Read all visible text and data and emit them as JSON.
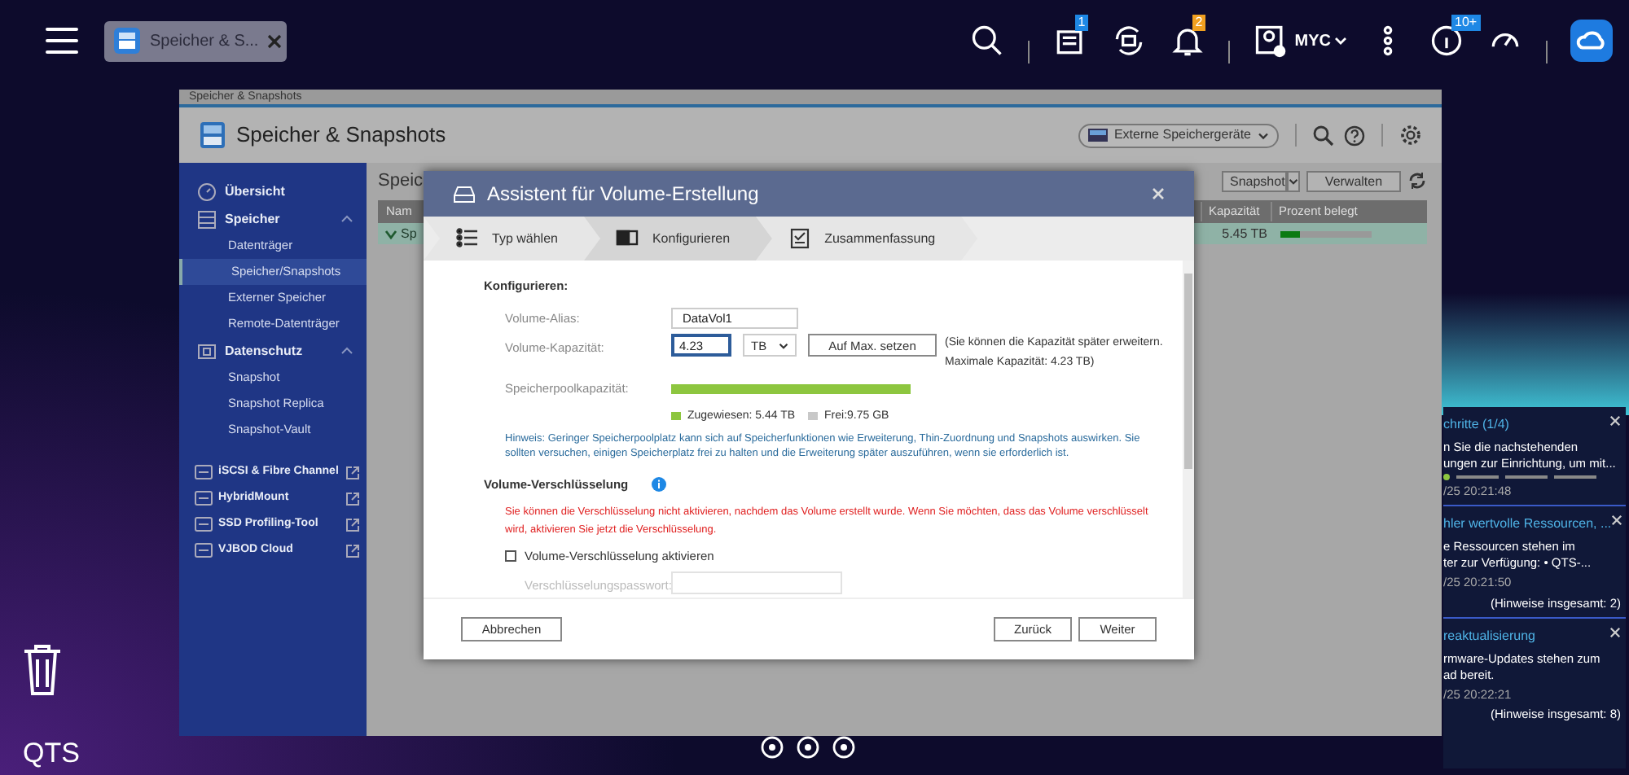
{
  "taskbar": {
    "tabs": [
      {
        "label": "Speicher & S...",
        "selected": true
      }
    ],
    "icons": [
      {
        "kind": "search"
      },
      {
        "kind": "divider"
      },
      {
        "kind": "tasks",
        "badge": "1"
      },
      {
        "kind": "sync"
      },
      {
        "kind": "bell",
        "badge": "2"
      },
      {
        "kind": "divider"
      },
      {
        "kind": "user",
        "label": "MYC"
      },
      {
        "kind": "more"
      },
      {
        "kind": "info",
        "badge": "10+"
      },
      {
        "kind": "gauge"
      },
      {
        "kind": "divider"
      },
      {
        "kind": "cloud"
      }
    ]
  },
  "app": {
    "window_title": "Speicher & Snapshots",
    "title": "Speicher & Snapshots",
    "external_button": "Externe Speichergeräte",
    "sidebar": [
      {
        "label": "Übersicht",
        "selected": false
      },
      {
        "label": "Speicher",
        "selected": false,
        "expanded": true,
        "children": [
          {
            "label": "Datenträger",
            "selected": false
          },
          {
            "label": "Speicher/Snapshots",
            "selected": true
          },
          {
            "label": "Externer Speicher",
            "selected": false
          },
          {
            "label": "Remote-Datenträger",
            "selected": false
          }
        ]
      },
      {
        "label": "Datenschutz",
        "selected": false,
        "expanded": true,
        "children": [
          {
            "label": "Snapshot",
            "selected": false
          },
          {
            "label": "Snapshot Replica",
            "selected": false
          },
          {
            "label": "Snapshot-Vault",
            "selected": false
          }
        ]
      }
    ],
    "tools": [
      {
        "label": "iSCSI & Fibre Channel"
      },
      {
        "label": "HybridMount"
      },
      {
        "label": "SSD Profiling-Tool"
      },
      {
        "label": "VJBOD Cloud"
      }
    ],
    "section_title": "Speic",
    "toolbar": [
      "Snapshot",
      "Verwalten"
    ],
    "table": {
      "columns": [
        "Nam",
        "Kapazität",
        "Prozent belegt"
      ],
      "rows": [
        {
          "name": "Sp",
          "capacity": "5.45 TB",
          "level": 0.22,
          "expanded": true
        }
      ]
    }
  },
  "dialog": {
    "title": "Assistent für Volume-Erstellung",
    "steps": [
      {
        "label": "Typ wählen",
        "selected": false
      },
      {
        "label": "Konfigurieren",
        "selected": true
      },
      {
        "label": "Zusammenfassung",
        "selected": false
      }
    ],
    "heading": "Konfigurieren:",
    "alias_label": "Volume-Alias:",
    "alias_value": "DataVol1",
    "capacity_label": "Volume-Kapazität:",
    "capacity_value": "4.23",
    "capacity_focused": true,
    "unit": "TB",
    "max_button": "Auf Max. setzen",
    "capacity_note": [
      "(Sie können die Kapazität später erweitern.",
      "Maximale Kapazität: 4.23 TB)"
    ],
    "pool": {
      "label": "Speicherpoolkapazität:",
      "level": 0.998
    },
    "legend": [
      {
        "label": "Zugewiesen: 5.44 TB",
        "color": "#8dc63f"
      },
      {
        "label": "Frei:9.75 GB",
        "color": "#c8c8c8"
      }
    ],
    "hint": "Hinweis: Geringer Speicherpoolplatz kann sich auf Speicherfunktionen wie Erweiterung, Thin-Zuordnung und Snapshots auswirken. Sie sollten versuchen, einigen Speicherplatz frei zu halten und die Erweiterung später auszuführen, wenn sie erforderlich ist.",
    "encryption_heading": "Volume-Verschlüsselung",
    "warning": "Sie können die Verschlüsselung nicht aktivieren, nachdem das Volume erstellt wurde. Wenn Sie möchten, dass das Volume verschlüsselt wird, aktivieren Sie jetzt die Verschlüsselung.",
    "encrypt_checkbox": {
      "label": "Volume-Verschlüsselung aktivieren",
      "checked": false
    },
    "password": {
      "label": "Verschlüsselungspasswort:",
      "disabled": true
    },
    "buttons": [
      "Abbrechen",
      "Zurück",
      "Weiter"
    ]
  },
  "notifications": [
    {
      "title": "chritte (1/4)",
      "lines": [
        "n Sie die nachstehenden",
        "ungen zur Einrichtung, um mit..."
      ],
      "time": "/25 20:21:48"
    },
    {
      "title": "hler wertvolle Ressourcen, ...",
      "lines": [
        "e Ressourcen stehen im",
        "ter zur Verfügung: • QTS-..."
      ],
      "time": "/25 20:21:50",
      "total": "(Hinweise insgesamt: 2)"
    },
    {
      "title": "reaktualisierung",
      "lines": [
        "rmware-Updates stehen zum",
        "ad bereit."
      ],
      "time": "/25 20:22:21",
      "total": "(Hinweise insgesamt: 8)"
    }
  ],
  "desktop": {
    "logo": "QTS"
  }
}
